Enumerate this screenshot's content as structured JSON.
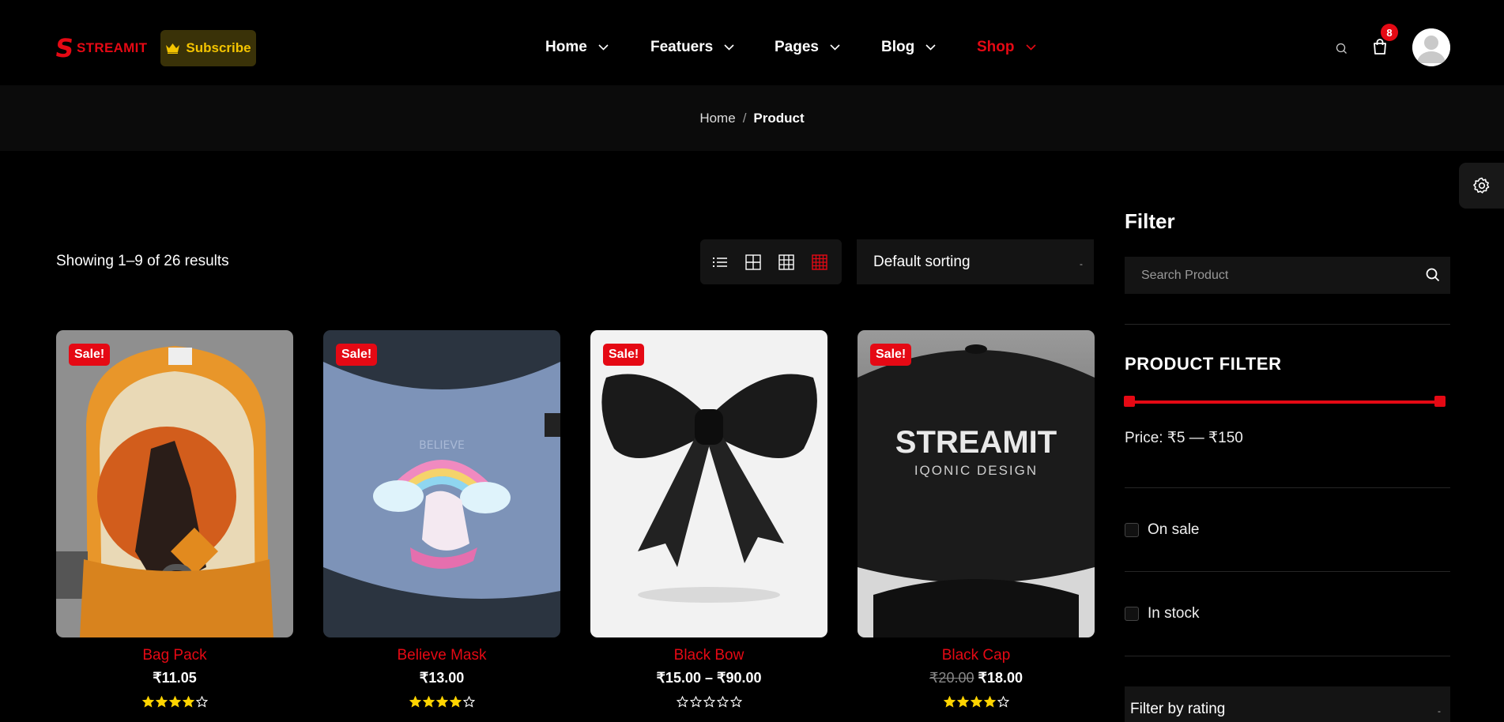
{
  "brand": {
    "logo_letter": "S",
    "name": "STREAMIT",
    "subscribe_label": "Subscribe"
  },
  "nav": [
    {
      "label": "Home"
    },
    {
      "label": "Featuers"
    },
    {
      "label": "Pages"
    },
    {
      "label": "Blog"
    },
    {
      "label": "Shop"
    }
  ],
  "header": {
    "cart_count": "8"
  },
  "breadcrumb": {
    "home": "Home",
    "separator": "/",
    "current": "Product"
  },
  "toolbar": {
    "results": "Showing 1–9 of 26 results",
    "sort_label": "Default sorting"
  },
  "products": [
    {
      "name": "Bag Pack",
      "sale": "Sale!",
      "price": "₹11.05",
      "old_price": "",
      "rating": 4
    },
    {
      "name": "Believe Mask",
      "sale": "Sale!",
      "price": "₹13.00",
      "old_price": "",
      "rating": 4
    },
    {
      "name": "Black Bow",
      "sale": "Sale!",
      "price": "₹15.00 – ₹90.00",
      "old_price": "",
      "rating": 0
    },
    {
      "name": "Black Cap",
      "sale": "Sale!",
      "price": "₹18.00",
      "old_price": "₹20.00",
      "rating": 4
    }
  ],
  "cap_print": {
    "line1": "STREAMIT",
    "line2": "IQONIC DESIGN"
  },
  "mask_print": "BELIEVE",
  "sidebar": {
    "filter_title": "Filter",
    "search_placeholder": "Search Product",
    "product_filter_title": "PRODUCT FILTER",
    "price_range": "Price: ₹5 — ₹150",
    "on_sale": "On sale",
    "in_stock": "In stock",
    "rating_label": "Filter by rating"
  },
  "colors": {
    "accent": "#e50914",
    "subscribe_text": "#f4c400",
    "star": "#ffd400"
  }
}
